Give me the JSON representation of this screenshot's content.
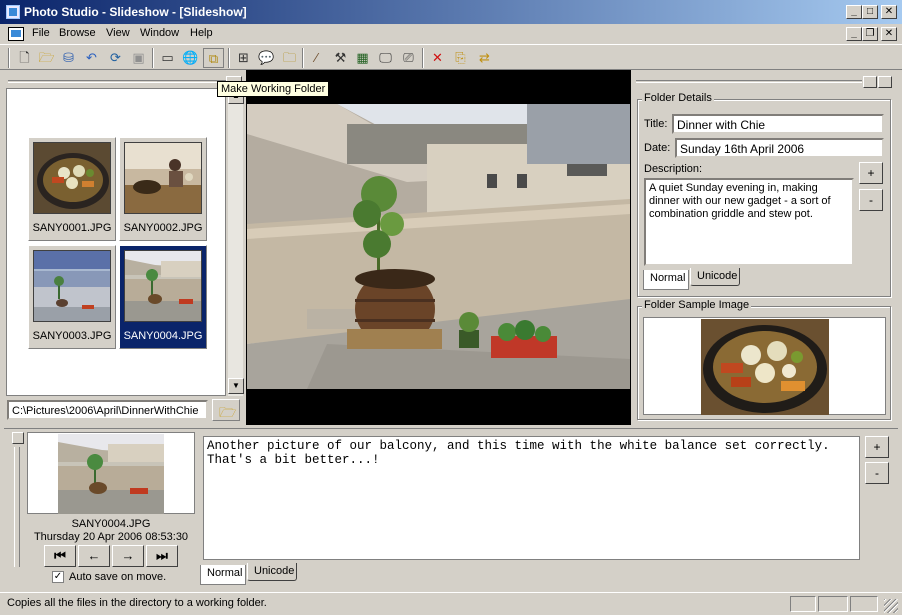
{
  "window": {
    "title": "Photo Studio - Slideshow - [Slideshow]"
  },
  "menu": [
    "File",
    "Browse",
    "View",
    "Window",
    "Help"
  ],
  "tooltip": "Make Working Folder",
  "thumbnails": [
    {
      "name": "SANY0001.JPG",
      "selected": false
    },
    {
      "name": "SANY0002.JPG",
      "selected": false
    },
    {
      "name": "SANY0003.JPG",
      "selected": false
    },
    {
      "name": "SANY0004.JPG",
      "selected": true
    }
  ],
  "path": "C:\\Pictures\\2006\\April\\DinnerWithChie",
  "folder_details": {
    "group_label": "Folder Details",
    "title_label": "Title:",
    "title_value": "Dinner with Chie",
    "date_label": "Date:",
    "date_value": "Sunday 16th April 2006",
    "description_label": "Description:",
    "description_value": "A quiet Sunday evening in, making dinner with our new gadget - a sort of combination griddle and stew pot.",
    "tab_normal": "Normal",
    "tab_unicode": "Unicode",
    "plus": "+",
    "minus": "-"
  },
  "sample_image": {
    "group_label": "Folder Sample Image"
  },
  "current": {
    "filename": "SANY0004.JPG",
    "datetime": "Thursday 20 Apr 2006 08:53:30",
    "autosave_label": "Auto save on move.",
    "autosave_checked": true,
    "comment": "Another picture of our balcony, and this time with the white balance set correctly. That's a bit better...!",
    "tab_normal": "Normal",
    "tab_unicode": "Unicode",
    "plus": "+",
    "minus": "-"
  },
  "status": {
    "text": "Copies all the files in the directory to a working folder."
  },
  "glyphs": {
    "first": "⏮",
    "prev": "←",
    "next": "→",
    "last": "⏭",
    "check": "✓",
    "up": "▲",
    "down": "▼",
    "min": "_",
    "max": "□",
    "restore": "❐",
    "close": "✕"
  }
}
